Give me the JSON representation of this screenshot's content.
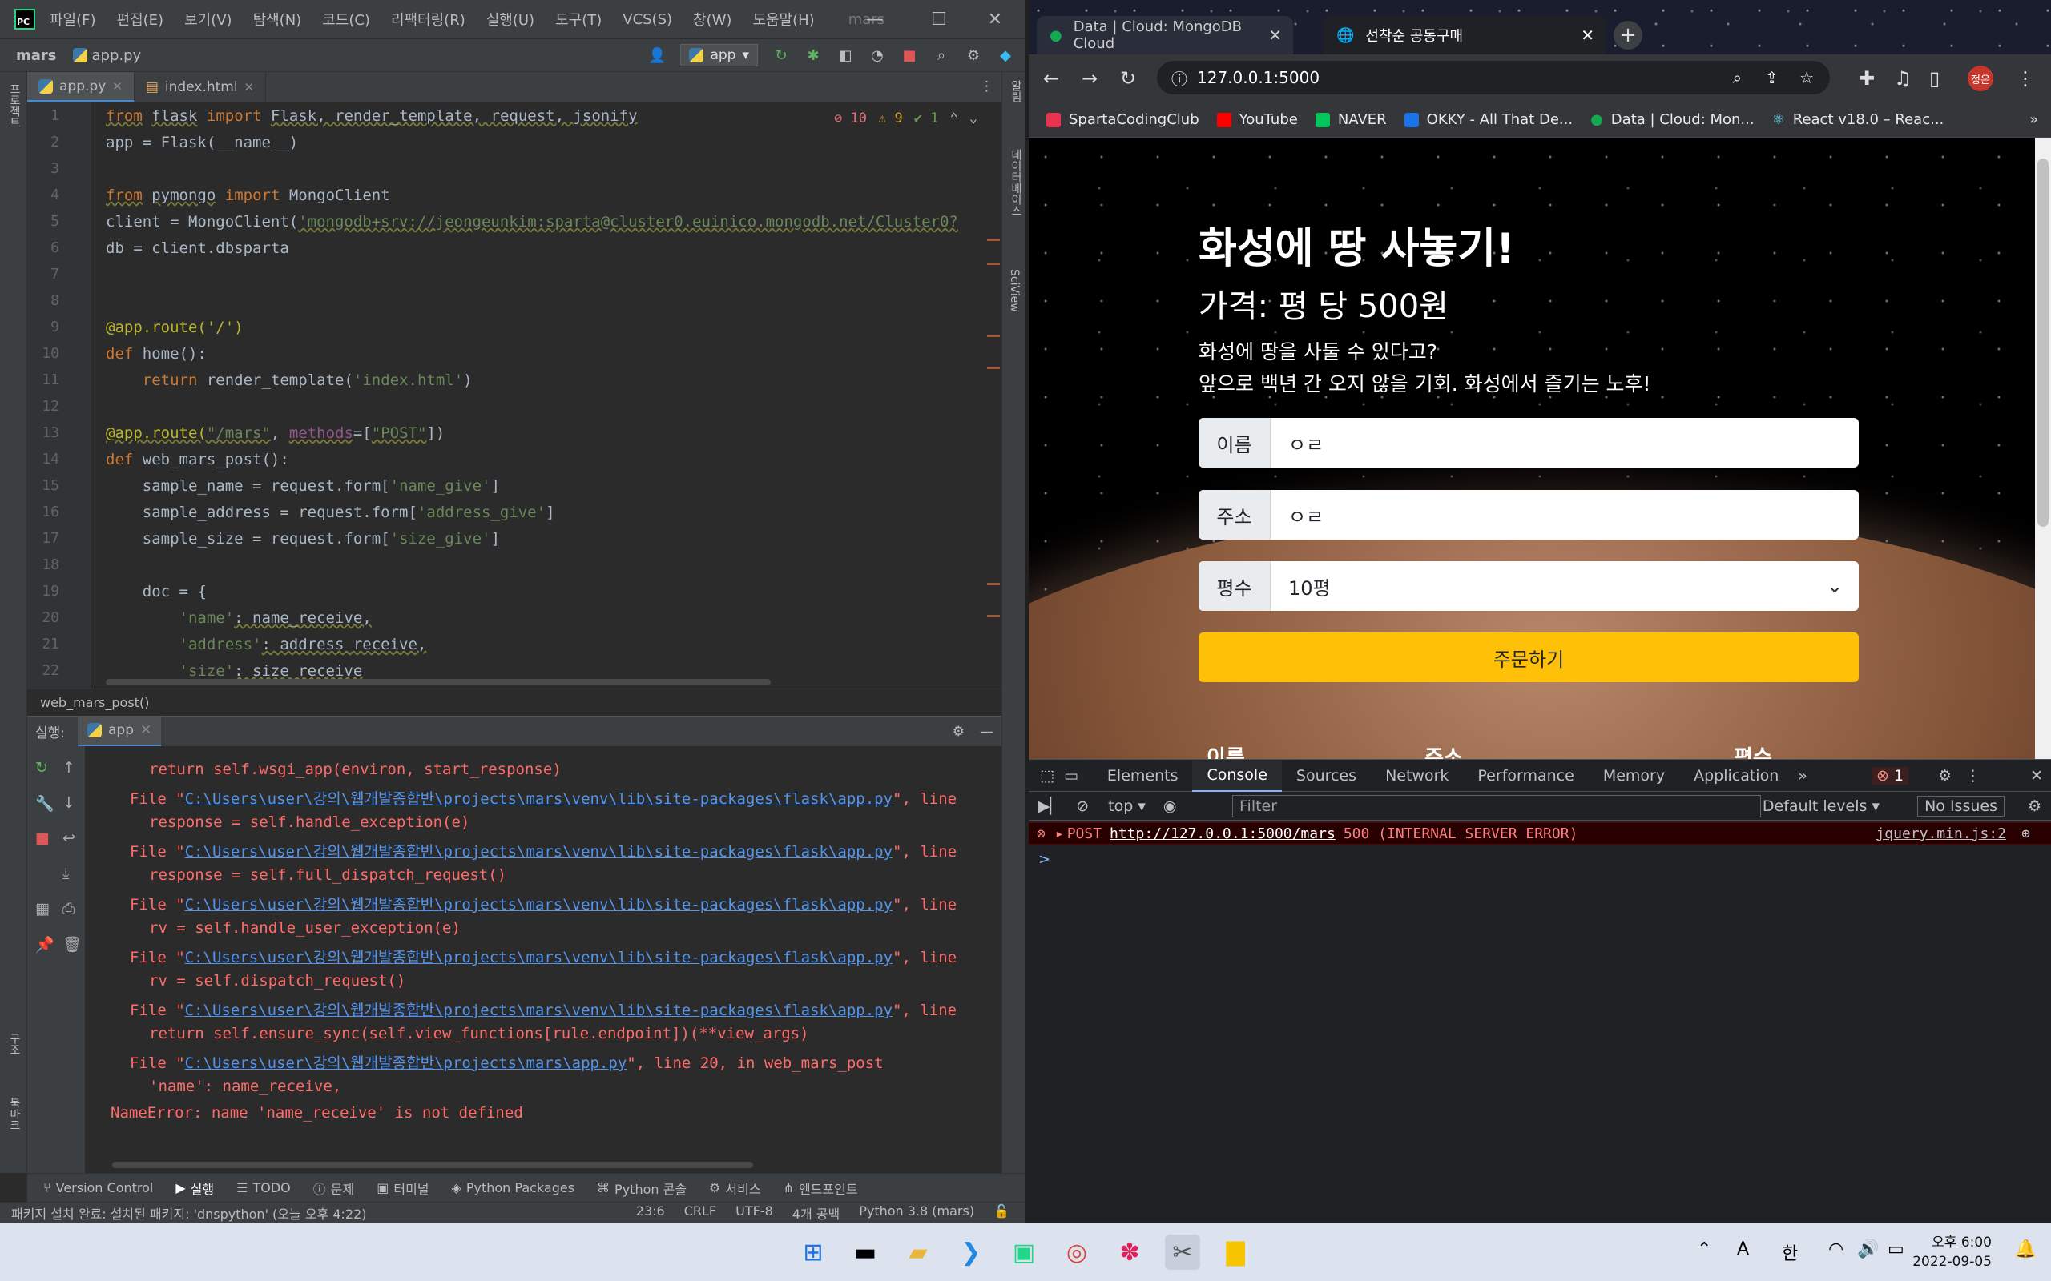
{
  "ide": {
    "menu": [
      "파일(F)",
      "편집(E)",
      "보기(V)",
      "탐색(N)",
      "코드(C)",
      "리팩터링(R)",
      "실행(U)",
      "도구(T)",
      "VCS(S)",
      "창(W)",
      "도움말(H)"
    ],
    "project_title": "mars",
    "breadcrumb_project": "mars",
    "breadcrumb_file": "app.py",
    "run_config": "app",
    "tabs": [
      {
        "label": "app.py"
      },
      {
        "label": "index.html"
      }
    ],
    "inspections": {
      "errors": "10",
      "warnings": "9",
      "ok": "1"
    },
    "left_strip": [
      "프로젝트",
      "구조",
      "북마크"
    ],
    "right_strip": [
      "알림",
      "데이터베이스",
      "SciView"
    ],
    "line_numbers": [
      "1",
      "2",
      "3",
      "4",
      "5",
      "6",
      "7",
      "8",
      "9",
      "10",
      "11",
      "12",
      "13",
      "14",
      "15",
      "16",
      "17",
      "18",
      "19",
      "20",
      "21",
      "22"
    ],
    "code": {
      "l1_kw": "from",
      "l1_mod": "flask",
      "l1_imp": "import",
      "l1_rest": "Flask, render_template, request, jsonify",
      "l2": "app = Flask(__name__)",
      "l4_kw": "from",
      "l4_mod": "pymongo",
      "l4_imp": "import",
      "l4_rest": "MongoClient",
      "l5_a": "client = MongoClient(",
      "l5_str": "'mongodb+srv://jeongeunkim:sparta@cluster0.euinico.mongodb.net/Cluster0?",
      "l6": "db = client.dbsparta",
      "l9": "@app.route('/')",
      "l10_kw": "def",
      "l10_rest": "home():",
      "l11_kw": "return",
      "l11_a": "render_template(",
      "l11_str": "'index.html'",
      "l11_b": ")",
      "l13_deco": "@app.route(",
      "l13_str": "\"/mars\"",
      "l13_comma": ", ",
      "l13_param": "methods",
      "l13_eq": "=[",
      "l13_str2": "\"POST\"",
      "l13_end": "])",
      "l14_kw": "def",
      "l14_rest": "web_mars_post():",
      "l15_a": "sample_name = request.form[",
      "l15_str": "'name_give'",
      "l15_b": "]",
      "l16_a": "sample_address = request.form[",
      "l16_str": "'address_give'",
      "l16_b": "]",
      "l17_a": "sample_size = request.form[",
      "l17_str": "'size_give'",
      "l17_b": "]",
      "l19": "doc = {",
      "l20_str": "'name'",
      "l20_b": ": name_receive,",
      "l21_str": "'address'",
      "l21_b": ": address_receive,",
      "l22_str": "'size'",
      "l22_b": ": size_receive"
    },
    "crumb_function": "web_mars_post()",
    "run_label": "실행:",
    "run_tab": "app",
    "console": {
      "c1": "return self.wsgi_app(environ, start_response)",
      "file_prefix": "File \"",
      "flask_path": "C:\\Users\\user\\강의\\웹개발종합반\\projects\\mars\\venv\\lib\\site-packages\\flask\\app.py",
      "line_suffix": "\", line",
      "c3": "response = self.handle_exception(e)",
      "c5": "response = self.full_dispatch_request()",
      "c7": "rv = self.handle_user_exception(e)",
      "c9": "rv = self.dispatch_request()",
      "c11": "return self.ensure_sync(self.view_functions[rule.endpoint])(**view_args)",
      "app_path": "C:\\Users\\user\\강의\\웹개발종합반\\projects\\mars\\app.py",
      "c12_suffix": "\", line 20, in web_mars_post",
      "c13": "'name': name_receive,",
      "c14": "NameError: name 'name_receive' is not defined"
    },
    "bottom_tabs": [
      "Version Control",
      "실행",
      "TODO",
      "문제",
      "터미널",
      "Python Packages",
      "Python 콘솔",
      "서비스",
      "엔드포인트"
    ],
    "status_message": "패키지 설치 완료: 설치된 패키지: 'dnspython' (오늘 오후 4:22)",
    "status_right": [
      "23:6",
      "CRLF",
      "UTF-8",
      "4개 공백",
      "Python 3.8 (mars)"
    ]
  },
  "browser": {
    "tabs": [
      {
        "title": "Data | Cloud: MongoDB Cloud"
      },
      {
        "title": "선착순 공동구매"
      }
    ],
    "url": "127.0.0.1:5000",
    "bookmarks": [
      "SpartaCodingClub",
      "YouTube",
      "NAVER",
      "OKKY - All That De...",
      "Data | Cloud: Mon...",
      "React v18.0 – Reac..."
    ],
    "profile": "정은",
    "page": {
      "title": "화성에 땅 사놓기!",
      "price": "가격: 평 당 500원",
      "desc1": "화성에 땅을 사둘 수 있다고?",
      "desc2": "앞으로 백년 간 오지 않을 기회. 화성에서 즐기는 노후!",
      "name_label": "이름",
      "name_value": "ㅇㄹ",
      "addr_label": "주소",
      "addr_value": "ㅇㄹ",
      "size_label": "평수",
      "size_value": "10평",
      "order_button": "주문하기",
      "table_headers": [
        "이름",
        "주소",
        "평수"
      ]
    },
    "devtools": {
      "tabs": [
        "Elements",
        "Console",
        "Sources",
        "Network",
        "Performance",
        "Memory",
        "Application"
      ],
      "error_count": "1",
      "context": "top",
      "filter_placeholder": "Filter",
      "levels": "Default levels",
      "issues": "No Issues",
      "error_method": "POST",
      "error_url": "http://127.0.0.1:5000/mars",
      "error_status": "500 (INTERNAL SERVER ERROR)",
      "error_source": "jquery.min.js:2",
      "prompt": ">"
    }
  },
  "taskbar": {
    "ime_a": "A",
    "ime_han": "한",
    "time": "오후 6:00",
    "date": "2022-09-05"
  }
}
